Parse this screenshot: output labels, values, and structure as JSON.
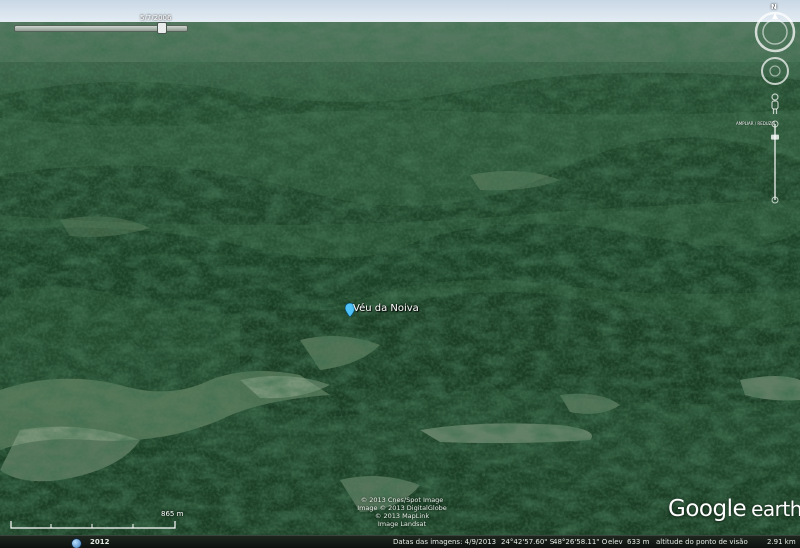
{
  "time_slider": {
    "date": "5/7/2006",
    "position_fraction": 0.88
  },
  "compass": {
    "north_label": "N"
  },
  "zoom_slider": {
    "label": "AMPLIAR / REDUZIR",
    "level_fraction": 0.15
  },
  "placemark": {
    "label": "Véu da Noiva",
    "color": "#4fc3f7"
  },
  "copyright": {
    "lines": [
      "© 2013 Cnes/Spot Image",
      "Image © 2013 DigitalGlobe",
      "© 2013 MapLink",
      "Image Landsat"
    ]
  },
  "scale": {
    "label": "865 m"
  },
  "logo": {
    "google": "Google",
    "earth": "earth"
  },
  "status_bar": {
    "year": "2012",
    "imagery_date": "Datas das imagens: 4/9/2013",
    "latitude": "24°42'57.60\" S",
    "longitude": "48°26'58.11\" O",
    "elev_label": "elev",
    "elevation": "633 m",
    "eye_alt_label": "altitude do ponto de visão",
    "eye_altitude": "2.91 km"
  },
  "colors": {
    "forest_dark": "#173d24",
    "forest_mid": "#2e5e38",
    "forest_light": "#4d7e52",
    "clearing": "#9eb59a",
    "sky": "#d7e3ee"
  },
  "icons": {
    "compass": "compass-ring-icon",
    "look": "look-joystick-icon",
    "street_view": "street-view-pegman-icon",
    "placemark": "placemark-pin-icon",
    "tour": "tour-globe-icon"
  }
}
